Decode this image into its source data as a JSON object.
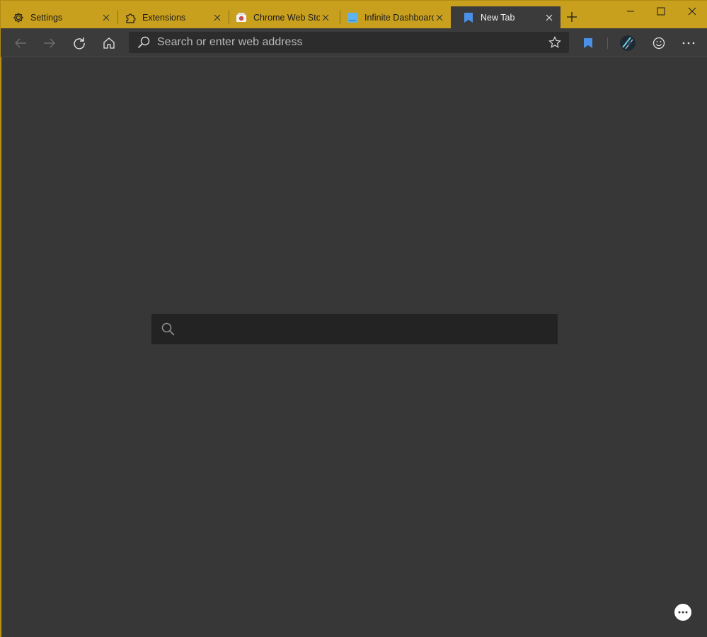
{
  "tabs": [
    {
      "title": "Settings",
      "icon": "gear-icon"
    },
    {
      "title": "Extensions",
      "icon": "puzzle-icon"
    },
    {
      "title": "Chrome Web Store",
      "icon": "chrome-web-store-icon"
    },
    {
      "title": "Infinite Dashboard",
      "icon": "dashboard-icon"
    },
    {
      "title": "New Tab",
      "icon": "bookmark-icon"
    }
  ],
  "address_bar": {
    "placeholder": "Search or enter web address"
  },
  "page": {
    "search_placeholder": ""
  },
  "colors": {
    "titlebar": "#c9a01e",
    "toolbar": "#3b3b3b",
    "content": "#373737",
    "page_search": "#232323",
    "accent_bookmark": "#4a8fe8"
  }
}
